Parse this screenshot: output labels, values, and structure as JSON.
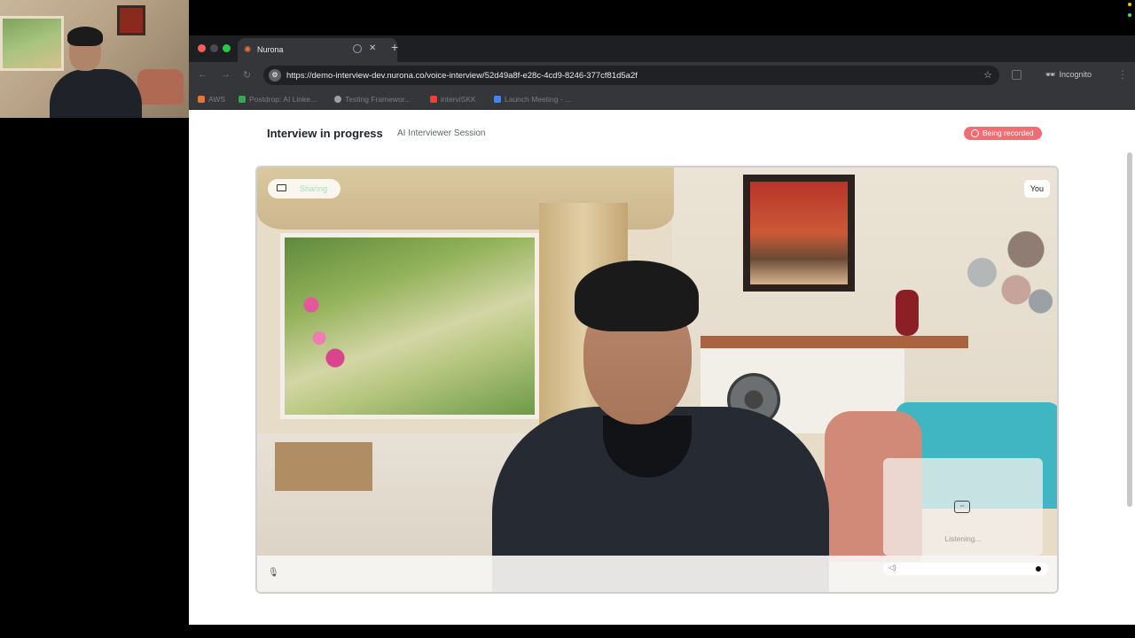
{
  "browser": {
    "tab_title": "Nurona",
    "url": "https://demo-interview-dev.nurona.co/voice-interview/52d49a8f-e28c-4cd9-8246-377cf81d5a2f",
    "profile_label": "Incognito"
  },
  "bookmarks": [
    {
      "label": "AWS",
      "color": "#e8743b"
    },
    {
      "label": "Postdrop: AI Linke...",
      "color": "#34a853"
    },
    {
      "label": "Testing Framewor...",
      "color": "#9aa0a6"
    },
    {
      "label": "interviSKK",
      "color": "#ea4335"
    },
    {
      "label": "Launch Meeting - ...",
      "color": "#4285f4"
    }
  ],
  "page": {
    "title": "Interview in progress",
    "subtitle": "AI Interviewer Session",
    "recording_badge": "Being recorded",
    "recording_color": "#f26d73"
  },
  "video": {
    "screen_share_label": "Sharing",
    "you_label": "You",
    "ai_status": "Listening..."
  },
  "icons": {
    "screen": "monitor-icon",
    "bot": "robot-icon",
    "mic": "microphone-icon",
    "speaker": "speaker-icon"
  }
}
